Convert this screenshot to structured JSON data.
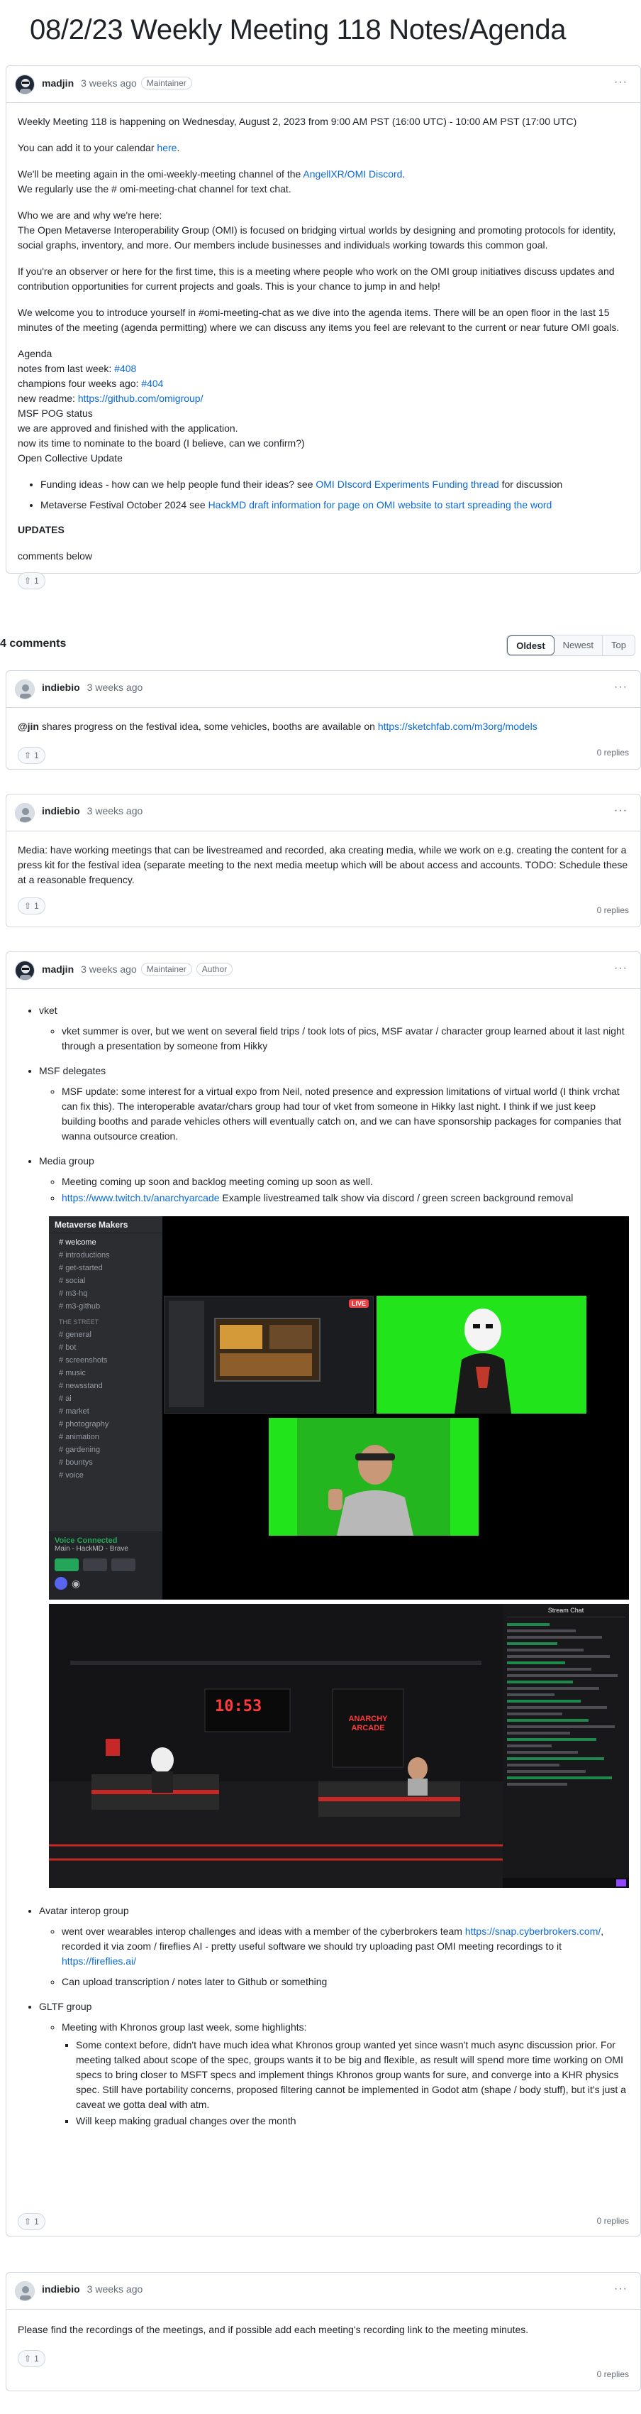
{
  "page": {
    "title": "08/2/23 Weekly Meeting 118 Notes/Agenda"
  },
  "post": {
    "author": "madjin",
    "time": "3 weeks ago",
    "badge": "Maintainer",
    "intro": "Weekly Meeting 118 is happening on Wednesday, August 2, 2023 from 9:00 AM PST (16:00 UTC) - 10:00 AM PST (17:00 UTC)",
    "calendar_prefix": "You can add it to your calendar ",
    "calendar_link": "here",
    "calendar_suffix": ".",
    "meet_prefix": "We'll be meeting again in the omi-weekly-meeting channel of the ",
    "meet_link": "AngellXR/OMI Discord",
    "meet_suffix": ".",
    "meet_line2": "We regularly use the # omi-meeting-chat channel for text chat.",
    "who_head": "Who we are and why we're here:",
    "who_text": "The Open Metaverse Interoperability Group (OMI) is focused on bridging virtual worlds by designing and promoting protocols for identity, social graphs, inventory, and more. Our members include businesses and individuals working towards this common goal.",
    "observer": "If you're an observer or here for the first time, this is a meeting where people who work on the OMI group initiatives discuss updates and contribution opportunities for current projects and goals. This is your chance to jump in and help!",
    "welcome": "We welcome you to introduce yourself in #omi-meeting-chat as we dive into the agenda items. There will be an open floor in the last 15 minutes of the meeting (agenda permitting) where we can discuss any items you feel are relevant to the current or near future OMI goals.",
    "agenda": "Agenda",
    "notes_prefix": "notes from last week: ",
    "notes_link": "#408",
    "champ_prefix": "champions four weeks ago: ",
    "champ_link": "#404",
    "readme_prefix": "new readme: ",
    "readme_link": "https://github.com/omigroup/",
    "msf": "MSF POG status",
    "approved": "we are approved and finished with the application.",
    "nominate": "now its time to nominate to the board (I believe, can we confirm?)",
    "collective": "Open Collective Update",
    "funding_prefix": "Funding ideas - how can we help people fund their ideas? see ",
    "funding_link": "OMI DIscord Experiments Funding thread",
    "funding_suffix": " for discussion",
    "festival_prefix": "Metaverse Festival October 2024 see ",
    "festival_link": "HackMD draft information for page on OMI website to start spreading the word",
    "updates": "UPDATES",
    "comments_below": "comments below",
    "reaction": "1"
  },
  "comments_header": {
    "count": "4 comments",
    "sort": [
      "Oldest",
      "Newest",
      "Top"
    ]
  },
  "comments": [
    {
      "author": "indiebio",
      "time": "3 weeks ago",
      "mention": "@jin",
      "text": " shares progress on the festival idea, some vehicles, booths are available on ",
      "link": "https://sketchfab.com/m3org/models",
      "reaction": "1",
      "replies": "0 replies"
    },
    {
      "author": "indiebio",
      "time": "3 weeks ago",
      "text": "Media: have working meetings that can be livestreamed and recorded, aka creating media, while we work on e.g. creating the content for a press kit for the festival idea (separate meeting to the next media meetup which will be about access and accounts. TODO: Schedule these at a reasonable frequency.",
      "reaction": "1",
      "replies": "0 replies"
    },
    {
      "author": "madjin",
      "time": "3 weeks ago",
      "badges": [
        "Maintainer",
        "Author"
      ],
      "vket": "vket",
      "vket_sub": "vket summer is over, but we went on several field trips / took lots of pics, MSF avatar / character group learned about it last night through a presentation by someone from Hikky",
      "msf": "MSF delegates",
      "msf_sub": "MSF update: some interest for a virtual expo from Neil, noted presence and expression limitations of virtual world (I think vrchat can fix this). The interoperable avatar/chars group had tour of vket from someone in Hikky last night. I think if we just keep building booths and parade vehicles others will eventually catch on, and we can have sponsorship packages for companies that wanna outsource creation.",
      "media": "Media group",
      "media_sub1": "Meeting coming up soon and backlog meeting coming up soon as well.",
      "media_link": "https://www.twitch.tv/anarchyarcade",
      "media_sub2": " Example livestreamed talk show via discord / green screen background removal",
      "discord": {
        "server": "Metaverse Makers",
        "channels": [
          "welcome",
          "introductions",
          "get-started",
          "social",
          "m3-hq",
          "m3-github"
        ],
        "section": "THE STREET",
        "channels2": [
          "general",
          "bot",
          "screenshots",
          "music",
          "newsstand",
          "ai",
          "market",
          "photography",
          "animation",
          "gardening",
          "bountys",
          "voice"
        ],
        "voice_status": "Voice Connected",
        "voice_place": "Main - HackMD - Brave",
        "live": "LIVE"
      },
      "stage": {
        "clock": "10:53",
        "sign": "ANARCHY ARCADE",
        "chat_title": "Stream Chat"
      },
      "avatar_head": "Avatar interop group",
      "avatar_sub1": "went over wearables interop challenges and ideas with a member of the cyberbrokers team ",
      "avatar_link": "https://snap.cyberbrokers.com/",
      "avatar_sub1b": ", recorded it via zoom / fireflies AI - pretty useful software we should try uploading past OMI meeting recordings to it ",
      "avatar_link2": "https://fireflies.ai/",
      "avatar_sub2": "Can upload transcription / notes later to Github or something",
      "gltf": "GLTF group",
      "gltf_sub": "Meeting with Khronos group last week, some highlights:",
      "gltf_sub1": "Some context before, didn't have much idea what Khronos group wanted yet since wasn't much async discussion prior. For meeting talked about scope of the spec, groups wants it to be big and flexible, as result will spend more time working on OMI specs to bring closer to MSFT specs and implement things Khronos group wants for sure, and converge into a KHR physics spec. Still have portability concerns, proposed filtering cannot be implemented in Godot atm (shape / body stuff), but it's just a caveat we gotta deal with atm.",
      "gltf_sub2": "Will keep making gradual changes over the month",
      "reaction": "1",
      "replies": "0 replies"
    },
    {
      "author": "indiebio",
      "time": "3 weeks ago",
      "text": "Please find the recordings of the meetings, and if possible add each meeting's recording link to the meeting minutes.",
      "reaction": "1",
      "replies": "0 replies"
    }
  ],
  "icons": {
    "thumbs_up": "arrow-up-icon",
    "kebab": "kebab-icon"
  },
  "colors": {
    "link": "#0969da",
    "green_screen": "#22e41a",
    "discord_bg": "#2b2d31",
    "live_red": "#ed4245"
  }
}
